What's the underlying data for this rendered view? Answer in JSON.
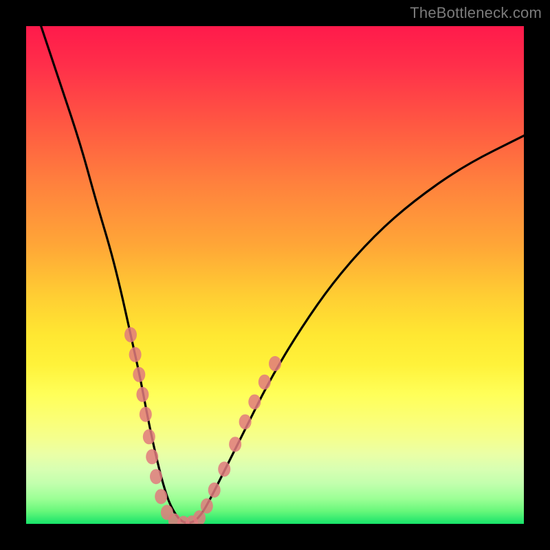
{
  "watermark": {
    "text": "TheBottleneck.com"
  },
  "colors": {
    "frame": "#000000",
    "curve": "#000000",
    "beads": "#e07a7e"
  },
  "chart_data": {
    "type": "line",
    "title": "",
    "xlabel": "",
    "ylabel": "",
    "xlim": [
      0,
      100
    ],
    "ylim": [
      0,
      100
    ],
    "legend": false,
    "grid": false,
    "background": "vertical-heat-gradient (red→yellow→green)",
    "series": [
      {
        "name": "bottleneck-curve",
        "comment": "Values estimated from pixel positions; x in % of plot width, y in % of plot height (0=bottom, 100=top).",
        "x": [
          3,
          7,
          11,
          14,
          17,
          19,
          21,
          23,
          24.5,
          26,
          27.5,
          29,
          31,
          33,
          35,
          37,
          40,
          44,
          49,
          55,
          62,
          70,
          78,
          88,
          100
        ],
        "y": [
          100,
          88,
          76,
          65,
          55,
          47,
          38,
          29,
          21,
          14,
          8,
          3.5,
          0.5,
          0,
          1.5,
          5,
          11,
          19,
          29,
          39,
          49,
          58,
          65,
          72,
          78
        ]
      }
    ],
    "markers": {
      "name": "highlight-beads",
      "comment": "Salmon dot markers clustered around the valley of the curve; y estimated like above.",
      "points": [
        {
          "x": 21.0,
          "y": 38
        },
        {
          "x": 21.9,
          "y": 34
        },
        {
          "x": 22.7,
          "y": 30
        },
        {
          "x": 23.4,
          "y": 26
        },
        {
          "x": 24.0,
          "y": 22
        },
        {
          "x": 24.7,
          "y": 17.5
        },
        {
          "x": 25.3,
          "y": 13.5
        },
        {
          "x": 26.1,
          "y": 9.5
        },
        {
          "x": 27.1,
          "y": 5.5
        },
        {
          "x": 28.3,
          "y": 2.3
        },
        {
          "x": 29.8,
          "y": 0.6
        },
        {
          "x": 31.6,
          "y": 0.1
        },
        {
          "x": 33.3,
          "y": 0.2
        },
        {
          "x": 34.8,
          "y": 1.2
        },
        {
          "x": 36.3,
          "y": 3.6
        },
        {
          "x": 37.8,
          "y": 6.8
        },
        {
          "x": 39.8,
          "y": 11.0
        },
        {
          "x": 42.0,
          "y": 16.0
        },
        {
          "x": 44.0,
          "y": 20.5
        },
        {
          "x": 45.9,
          "y": 24.5
        },
        {
          "x": 47.9,
          "y": 28.5
        },
        {
          "x": 50.0,
          "y": 32.2
        }
      ]
    }
  }
}
